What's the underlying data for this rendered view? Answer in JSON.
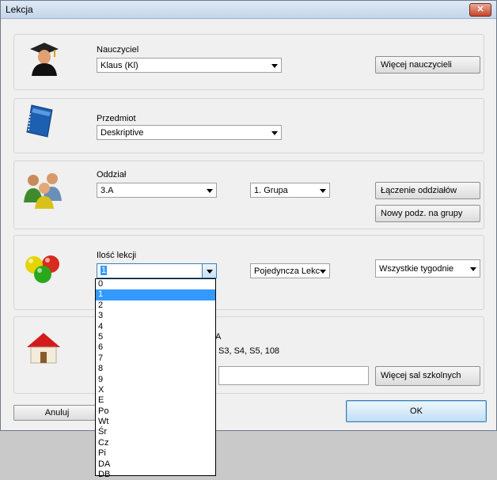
{
  "window": {
    "title": "Lekcja",
    "close_glyph": "✕"
  },
  "teacher": {
    "label": "Nauczyciel",
    "value": "Klaus (Kl)",
    "more_button": "Więcej nauczycieli",
    "icon": "teacher-icon"
  },
  "subject": {
    "label": "Przedmiot",
    "value": "Deskriptive",
    "icon": "book-icon"
  },
  "class": {
    "label": "Oddział",
    "value": "3.A",
    "group_value": "1. Grupa",
    "join_button": "Łączenie oddziałów",
    "new_split_button": "Nowy podz. na grupy",
    "icon": "people-icon"
  },
  "lessons": {
    "label": "Ilość lekcji",
    "value": "1",
    "type_value": "Pojedyncza Lekc",
    "weeks_value": "Wszystkie tygodnie",
    "options": [
      "0",
      "1",
      "2",
      "3",
      "4",
      "5",
      "6",
      "7",
      "8",
      "9",
      "X",
      "E",
      "Po",
      "Wt",
      "Śr",
      "Cz",
      "Pi",
      "DA",
      "DB"
    ],
    "selected_index": 1,
    "icon": "balls-icon"
  },
  "room": {
    "partial_label": "A",
    "partial_rooms": "S3, S4, S5, 108",
    "more_button": "Więcej sal szkolnych",
    "icon": "house-icon"
  },
  "footer": {
    "cancel": "Anuluj",
    "ok": "OK"
  }
}
